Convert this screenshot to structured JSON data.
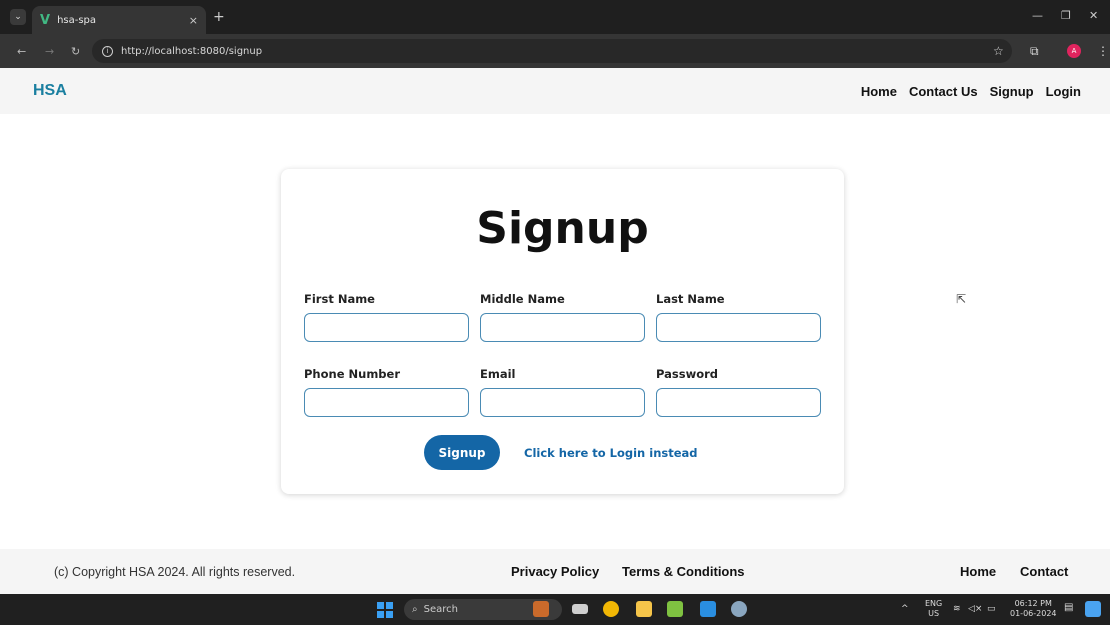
{
  "browser": {
    "tab_title": "hsa-spa",
    "tab_close": "×",
    "new_tab": "+",
    "url": "http://localhost:8080/signup",
    "profile_initial": "A"
  },
  "header": {
    "brand": "HSA",
    "nav": [
      "Home",
      "Contact Us",
      "Signup",
      "Login"
    ]
  },
  "form": {
    "title": "Signup",
    "fields": [
      {
        "label": "First Name",
        "value": ""
      },
      {
        "label": "Middle Name",
        "value": ""
      },
      {
        "label": "Last Name",
        "value": ""
      },
      {
        "label": "Phone Number",
        "value": ""
      },
      {
        "label": "Email",
        "value": ""
      },
      {
        "label": "Password",
        "value": ""
      }
    ],
    "submit_label": "Signup",
    "login_link": "Click here to Login instead"
  },
  "footer": {
    "copyright": "(c) Copyright HSA 2024. All rights reserved.",
    "privacy": "Privacy Policy",
    "terms": "Terms & Conditions",
    "home": "Home",
    "contact": "Contact"
  },
  "taskbar": {
    "search_placeholder": "Search",
    "lang_top": "ENG",
    "lang_bottom": "US",
    "time": "06:12 PM",
    "date": "01-06-2024"
  },
  "colors": {
    "brand": "#1a7fa0",
    "primary": "#1466a6",
    "input_border": "#4a8bb4"
  }
}
